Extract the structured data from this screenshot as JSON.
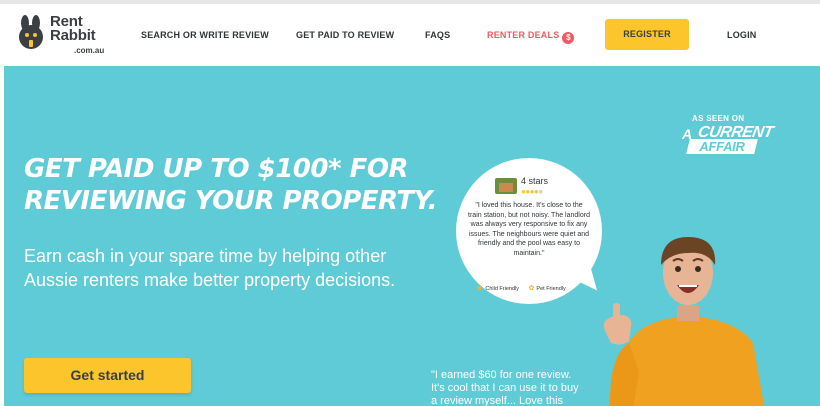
{
  "nav": {
    "logo_line1": "Rent",
    "logo_line2": "Rabbit",
    "logo_sub": ".com.au",
    "links": {
      "search": "SEARCH OR WRITE REVIEW",
      "get_paid": "GET PAID TO REVIEW",
      "faqs": "FAQS",
      "deals": "RENTER DEALS",
      "deals_badge": "$"
    },
    "register": "REGISTER",
    "login": "LOGIN"
  },
  "hero": {
    "title_line1": "GET PAID UP TO $100* FOR",
    "title_line2": "REVIEWING YOUR PROPERTY.",
    "sub_line1": "Earn cash in your spare time by helping other",
    "sub_line2": "Aussie renters make better property decisions.",
    "cta": "Get started",
    "as_seen_on": "AS SEEN ON",
    "aca_a": "A",
    "aca_current": "CURRENT",
    "aca_affair": "AFFAIR",
    "testimonial_line1": "\"I earned $60 for one review.",
    "testimonial_line2": "It's cool that I can use it to buy",
    "testimonial_line3": "a review myself... Love this"
  },
  "review": {
    "stars_label": "4 stars",
    "rating": 4,
    "rating_max": 5,
    "text": "\"I loved this house. It's close to the train station, but not noisy. The landlord was always very responsive to fix any issues. The neighbours were quiet and friendly and the pool was easy to maintain.\"",
    "tag1": "Child Friendly",
    "tag2": "Pet Friendly"
  },
  "colors": {
    "hero_bg": "#5ecbd6",
    "accent_yellow": "#fbc52b",
    "deals_red": "#ef5a61"
  }
}
